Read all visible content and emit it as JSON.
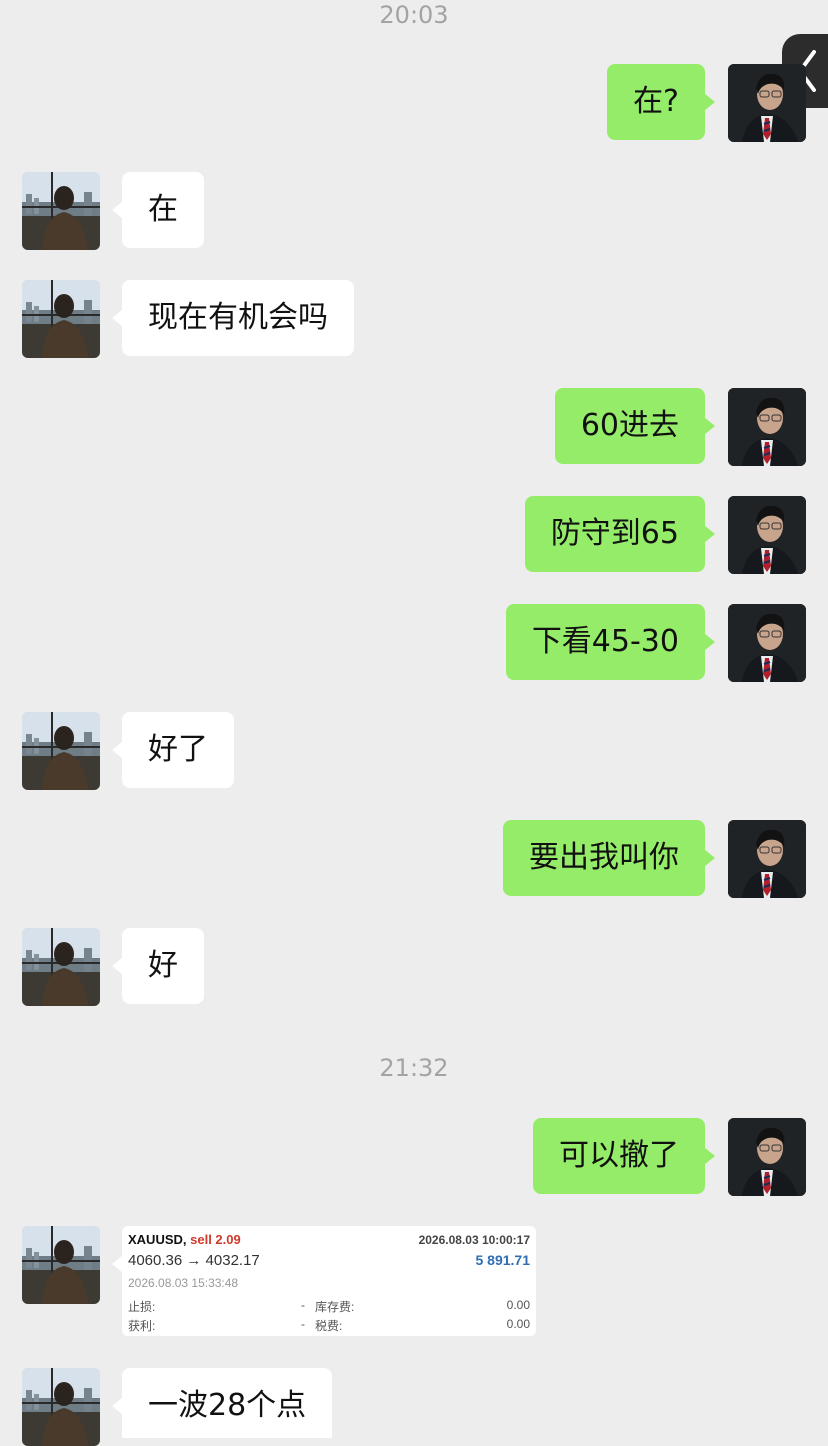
{
  "times": {
    "first": "20:03",
    "second": "21:32"
  },
  "messages": [
    {
      "side": "me",
      "text": "在?"
    },
    {
      "side": "them",
      "text": "在"
    },
    {
      "side": "them",
      "text": "现在有机会吗"
    },
    {
      "side": "me",
      "text": "60进去"
    },
    {
      "side": "me",
      "text": "防守到65"
    },
    {
      "side": "me",
      "text": "下看45-30"
    },
    {
      "side": "them",
      "text": "好了"
    },
    {
      "side": "me",
      "text": "要出我叫你"
    },
    {
      "side": "them",
      "text": "好"
    },
    {
      "side": "me",
      "text": "可以撤了"
    },
    {
      "side": "them",
      "text": "一波28个点"
    }
  ],
  "trade_card": {
    "symbol": "XAUUSD,",
    "side_lots": "sell 2.09",
    "open_time": "2026.08.03 10:00:17",
    "prices": "4060.36 → 4032.17",
    "profit": "5 891.71",
    "close_time": "2026.08.03 15:33:48",
    "stop_loss_label": "止损:",
    "stop_loss_value": "-",
    "swap_label": "库存费:",
    "swap_value": "0.00",
    "take_profit_label": "获利:",
    "take_profit_value": "-",
    "tax_label": "税费:",
    "tax_value": "0.00"
  },
  "colors": {
    "my_bubble": "#95ec69",
    "their_bubble": "#ffffff",
    "background": "#ededed",
    "sell": "#d0392b",
    "profit": "#2f6db5"
  }
}
